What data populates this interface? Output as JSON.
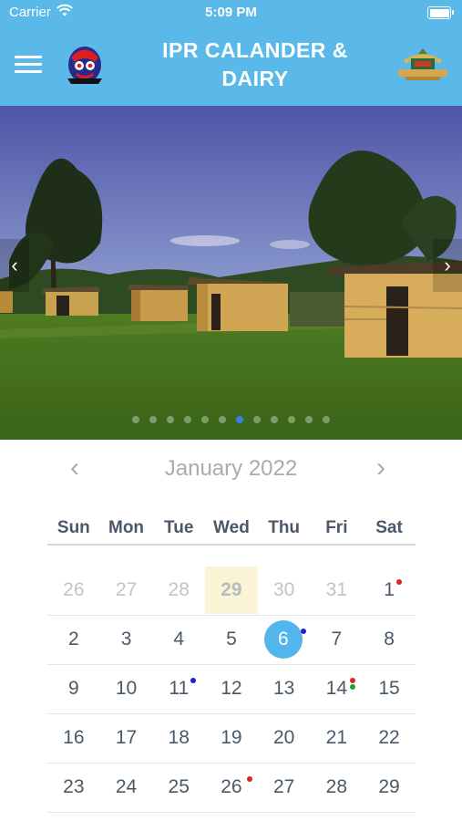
{
  "status_bar": {
    "carrier": "Carrier",
    "time": "5:09 PM"
  },
  "header": {
    "title_line1": "IPR CALANDER &",
    "title_line2": "DAIRY"
  },
  "calendar": {
    "month_label": "January 2022",
    "prev_glyph": "‹",
    "next_glyph": "›",
    "weekdays": [
      "Sun",
      "Mon",
      "Tue",
      "Wed",
      "Thu",
      "Fri",
      "Sat"
    ],
    "weeks": [
      [
        "26",
        "27",
        "28",
        "29",
        "30",
        "31",
        "1"
      ],
      [
        "2",
        "3",
        "4",
        "5",
        "6",
        "7",
        "8"
      ],
      [
        "9",
        "10",
        "11",
        "12",
        "13",
        "14",
        "15"
      ],
      [
        "16",
        "17",
        "18",
        "19",
        "20",
        "21",
        "22"
      ],
      [
        "23",
        "24",
        "25",
        "26",
        "27",
        "28",
        "29"
      ]
    ],
    "selected_day": "6",
    "highlighted_day": "29"
  },
  "carousel": {
    "prev_glyph": "‹",
    "next_glyph": "›",
    "dot_count": 12,
    "active_dot": 6
  },
  "colors": {
    "accent": "#5bb9e9",
    "event_red": "#e12222",
    "event_blue": "#1c1ee0",
    "event_green": "#1f9e3a"
  },
  "icons": [
    "menu-icon",
    "ipr-emblem-logo",
    "government-seal-logo",
    "chevron-left-icon",
    "chevron-right-icon",
    "wifi-icon",
    "battery-icon"
  ]
}
